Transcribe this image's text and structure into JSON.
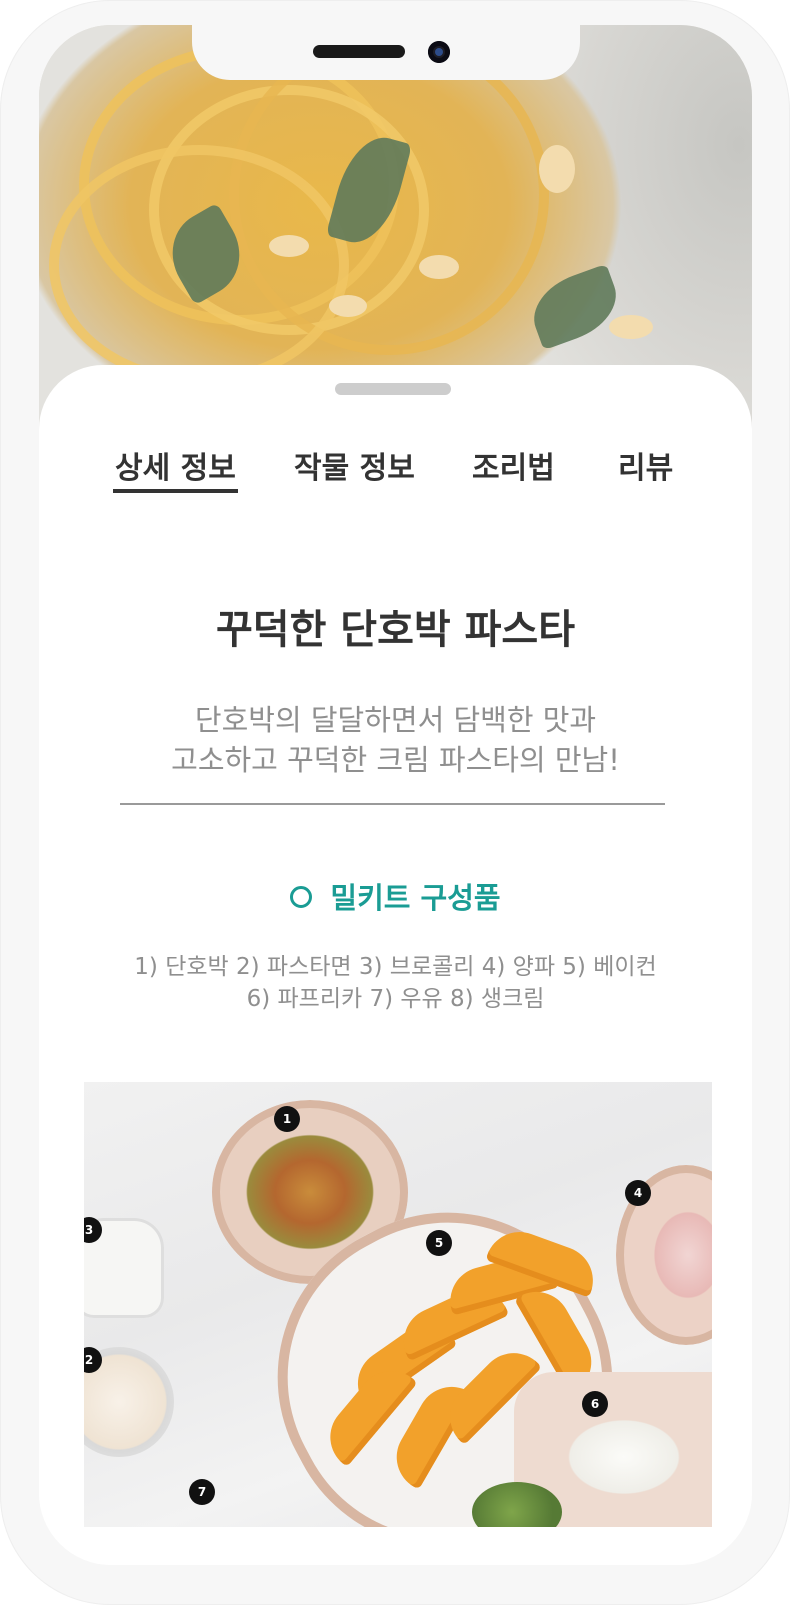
{
  "tabs": [
    {
      "label": "상세 정보",
      "active": true
    },
    {
      "label": "작물 정보",
      "active": false
    },
    {
      "label": "조리법",
      "active": false
    },
    {
      "label": "리뷰",
      "active": false
    }
  ],
  "recipe": {
    "title": "꾸덕한 단호박 파스타",
    "description_line1": "단호박의 달달하면서 담백한 맛과",
    "description_line2": "고소하고 꾸덕한 크림 파스타의 만남!"
  },
  "meal_kit": {
    "heading": "밀키트 구성품",
    "ingredients_line1": "1) 단호박 2) 파스타면 3) 브로콜리 4) 양파 5) 베이컨",
    "ingredients_line2": "6) 파프리카 7) 우유 8) 생크림",
    "photo_badges": [
      "1",
      "2",
      "3",
      "4",
      "5",
      "6",
      "7"
    ]
  },
  "colors": {
    "accent": "#1a9c94",
    "text_primary": "#333333",
    "text_secondary": "#8f8f8f"
  },
  "icons": {
    "section_marker": "circle-outline-icon"
  }
}
